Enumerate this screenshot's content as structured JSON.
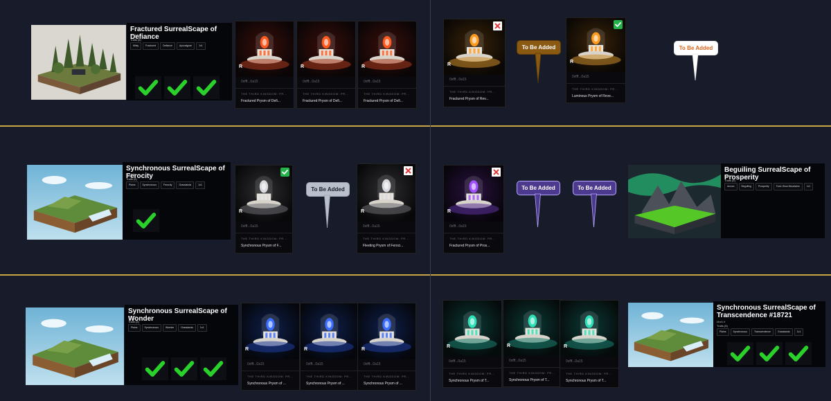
{
  "colors": {
    "background": "#171b2a",
    "divider": "#c9a545",
    "check_green": "#2bd12b",
    "badge_green": "#24b24a",
    "badge_red": "#e23a3a",
    "callout_brown": "#8a5a12",
    "callout_gray": "#b9c0cc",
    "callout_purple": "#4b3a8e",
    "callout_white": "#ffffff"
  },
  "common": {
    "owner": "Mark It",
    "address": "0xfff...0a15",
    "collection": "THE THIRD KINGDOM: PR...",
    "callout_text": "To Be Added",
    "logo": "R"
  },
  "rows": [
    {
      "left": {
        "scape": {
          "title": "Fractured SurrealScape of Defiance",
          "traits_label": "Traits (5)",
          "traits": [
            "Misty",
            "Fractured",
            "Defiance",
            "Apocalypse",
            "1x1"
          ],
          "checks": 3,
          "scene": "forest"
        },
        "prysms": [
          {
            "name": "Fractured Prysm of Defi...",
            "color": "red",
            "badge": null
          },
          {
            "name": "Fractured Prysm of Defi...",
            "color": "red",
            "badge": null
          },
          {
            "name": "Fractured Prysm of Defi...",
            "color": "red",
            "badge": null
          }
        ]
      },
      "right": {
        "prysms": [
          {
            "name": "Fractured Prysm of Rev...",
            "color": "amber",
            "badge": "cross"
          },
          {
            "name": "Luminous Prysm of Reve...",
            "color": "amber",
            "badge": "check"
          }
        ],
        "callouts": [
          "To Be Added",
          "To Be Added"
        ]
      }
    },
    {
      "left": {
        "scape": {
          "title": "Synchronous SurrealScape of Ferocity",
          "traits_label": "Traits (5)",
          "traits": [
            "Plains",
            "Synchronous",
            "Ferocity",
            "Grasslands",
            "1x1"
          ],
          "checks": 1,
          "scene": "island"
        },
        "prysms": [
          {
            "name": "Synchronous Prysm of F...",
            "color": "white",
            "badge": "check"
          },
          {
            "name": "Fleeting Prysm of Feroci...",
            "color": "white",
            "badge": "cross"
          }
        ],
        "callouts": [
          "To Be Added"
        ]
      },
      "right": {
        "prysms": [
          {
            "name": "Fractured Prysm of Pros...",
            "color": "purple",
            "badge": "cross"
          }
        ],
        "callouts": [
          "To Be Added",
          "To Be Added"
        ],
        "scape": {
          "title": "Beguiling SurrealScape of Prosperity",
          "traits_label": "Traits (5)",
          "traits": [
            "Aurora",
            "Beguiling",
            "Prosperity",
            "Toxic Glow Mountains",
            "1x1"
          ],
          "checks": 0,
          "scene": "aurora"
        }
      }
    },
    {
      "left": {
        "scape": {
          "title": "Synchronous SurrealScape of Wonder",
          "traits_label": "Traits (5)",
          "traits": [
            "Plains",
            "Synchronous",
            "Wonder",
            "Grasslands",
            "1x1"
          ],
          "checks": 3,
          "scene": "island"
        },
        "prysms": [
          {
            "name": "Synchronous Prysm of ...",
            "color": "blue",
            "badge": null
          },
          {
            "name": "Synchronous Prysm of ...",
            "color": "blue",
            "badge": null
          },
          {
            "name": "Synchronous Prysm of ...",
            "color": "blue",
            "badge": null
          }
        ]
      },
      "right": {
        "prysms": [
          {
            "name": "Synchronous Prysm of T...",
            "color": "teal",
            "badge": null
          },
          {
            "name": "Synchronous Prysm of T...",
            "color": "teal",
            "badge": null
          },
          {
            "name": "Synchronous Prysm of T...",
            "color": "teal",
            "badge": null
          }
        ],
        "scape": {
          "title": "Synchronous SurrealScape of Transcendence #18721",
          "traits_label": "Traits (5)",
          "traits": [
            "Plains",
            "Synchronous",
            "Transcendence",
            "Grasslands",
            "1x1"
          ],
          "checks": 3,
          "scene": "island"
        }
      }
    }
  ]
}
